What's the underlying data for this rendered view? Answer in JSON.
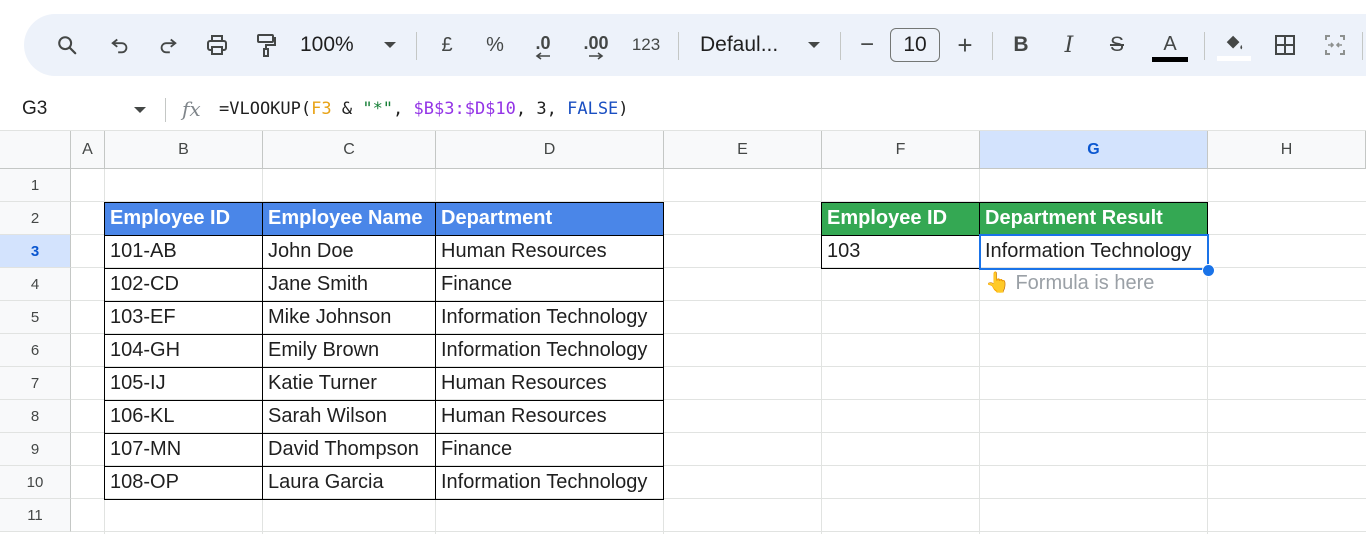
{
  "toolbar": {
    "zoom": "100%",
    "currency": "£",
    "percent": "%",
    "decrease_decimal": ".0",
    "increase_decimal": ".00",
    "number_format": "123",
    "font_name": "Defaul...",
    "minus": "−",
    "font_size": "10",
    "plus": "+",
    "bold": "B",
    "italic": "I",
    "strikethrough": "S",
    "text_color": "A"
  },
  "formula_bar": {
    "cell_ref": "G3",
    "fx": "fx",
    "formula_parts": {
      "p1": "=VLOOKUP(",
      "p2": "F3",
      "p3": " & ",
      "p4": "\"*\"",
      "p5": ", ",
      "p6": "$B$3:$D$10",
      "p7": ", ",
      "p8": "3",
      "p9": ", ",
      "p10": "FALSE",
      "p11": ")"
    }
  },
  "columns": [
    "A",
    "B",
    "C",
    "D",
    "E",
    "F",
    "G",
    "H"
  ],
  "rows": [
    "1",
    "2",
    "3",
    "4",
    "5",
    "6",
    "7",
    "8",
    "9",
    "10",
    "11"
  ],
  "table": {
    "headers": [
      "Employee ID",
      "Employee Name",
      "Department"
    ],
    "rows": [
      [
        "101-AB",
        "John Doe",
        "Human Resources"
      ],
      [
        "102-CD",
        "Jane Smith",
        "Finance"
      ],
      [
        "103-EF",
        "Mike Johnson",
        "Information Technology"
      ],
      [
        "104-GH",
        "Emily Brown",
        "Information Technology"
      ],
      [
        "105-IJ",
        "Katie Turner",
        "Human Resources"
      ],
      [
        "106-KL",
        "Sarah Wilson",
        "Human Resources"
      ],
      [
        "107-MN",
        "David Thompson",
        "Finance"
      ],
      [
        "108-OP",
        "Laura Garcia",
        "Information Technology"
      ]
    ]
  },
  "lookup": {
    "headers": [
      "Employee ID",
      "Department Result"
    ],
    "id_value": "103",
    "result_value": "Information Technology",
    "note": "👆 Formula is here"
  },
  "colors": {
    "table_header": "#4a86e8",
    "lookup_header": "#34a853",
    "selection": "#1a73e8"
  }
}
